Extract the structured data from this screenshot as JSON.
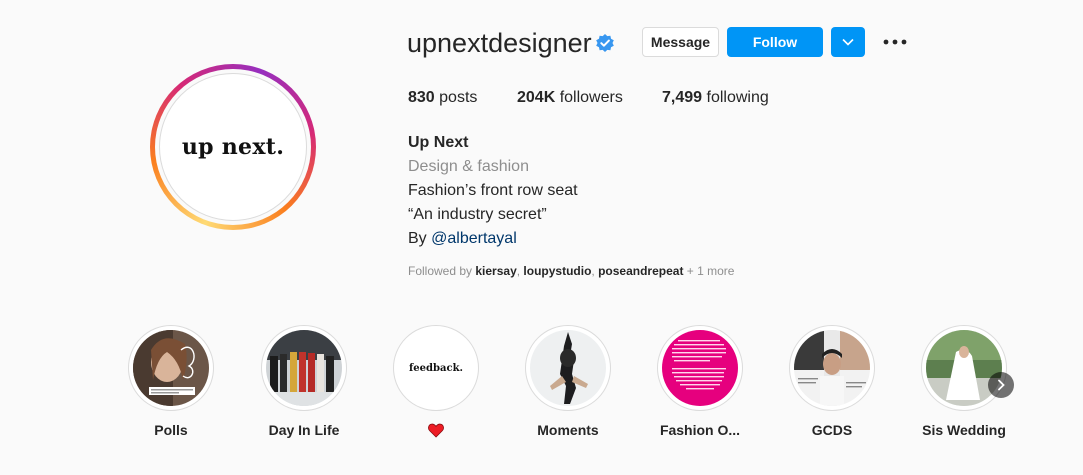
{
  "profile": {
    "username": "upnextdesigner",
    "avatar_text": "up next.",
    "verified": true,
    "buttons": {
      "message": "Message",
      "follow": "Follow"
    },
    "stats": {
      "posts_count": "830",
      "posts_label": " posts",
      "followers_count": "204K",
      "followers_label": " followers",
      "following_count": "7,499",
      "following_label": " following"
    },
    "bio": {
      "name": "Up Next",
      "category": "Design & fashion",
      "line1": "Fashion’s front row seat",
      "line2": "“An industry secret”",
      "line3_prefix": "By ",
      "line3_mention": "@albertayal"
    },
    "followed_by": {
      "prefix": "Followed by ",
      "users": [
        "kiersay",
        "loupystudio",
        "poseandrepeat"
      ],
      "suffix": " + 1 more"
    }
  },
  "highlights": [
    {
      "label": "Polls",
      "icon": "photo-woman-poll"
    },
    {
      "label": "Day In Life",
      "icon": "photo-runway"
    },
    {
      "label": "",
      "icon": "heart-icon",
      "cover_text": "feedback."
    },
    {
      "label": "Moments",
      "icon": "photo-dancer"
    },
    {
      "label": "Fashion O...",
      "icon": "pink-text-cover"
    },
    {
      "label": "GCDS",
      "icon": "photo-collage"
    },
    {
      "label": "Sis Wedding",
      "icon": "photo-wedding"
    }
  ],
  "colors": {
    "accent": "#0095f6",
    "heart": "#ed1c24",
    "pink_cover": "#e6007e"
  }
}
